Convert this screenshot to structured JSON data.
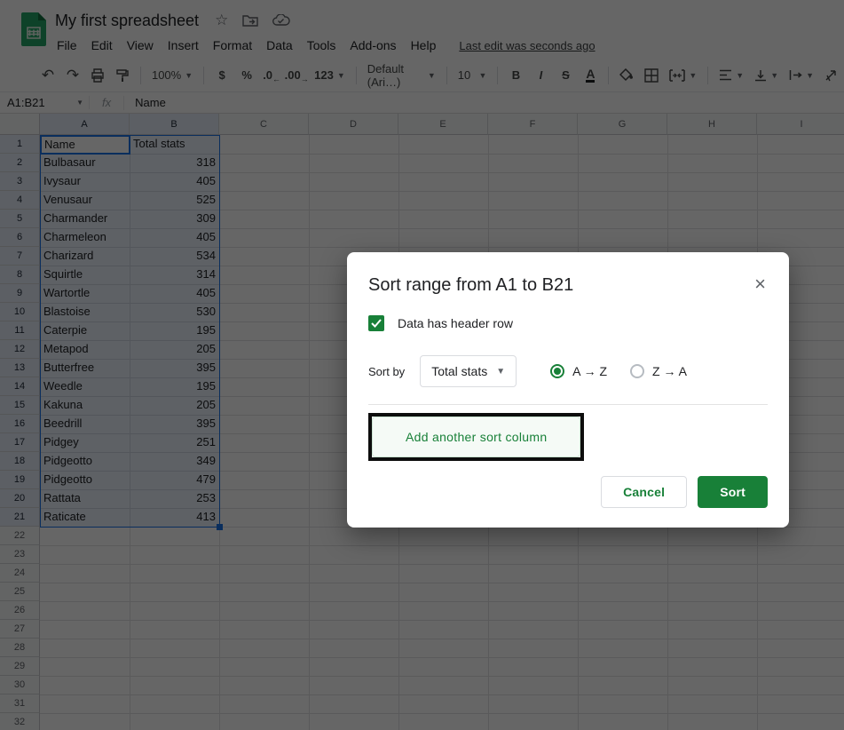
{
  "app": {
    "title": "My first spreadsheet",
    "last_edit": "Last edit was seconds ago",
    "menus": [
      "File",
      "Edit",
      "View",
      "Insert",
      "Format",
      "Data",
      "Tools",
      "Add-ons",
      "Help"
    ]
  },
  "toolbar": {
    "undo": "↶",
    "redo": "↷",
    "zoom": "100%",
    "currency": "$",
    "percent": "%",
    "decimal_decrease": ".0",
    "decimal_increase": ".00",
    "more_formats": "123",
    "font": "Default (Ari…)",
    "font_size": "10",
    "bold": "B",
    "italic": "I",
    "strikethrough": "S",
    "text_color": "A"
  },
  "formula_bar": {
    "name_box": "A1:B21",
    "fx": "fx",
    "content": "Name"
  },
  "grid": {
    "columns": [
      "A",
      "B",
      "C",
      "D",
      "E",
      "F",
      "G",
      "H",
      "I"
    ],
    "visible_row_count": 32,
    "selected_range_rows": 21,
    "table": {
      "headers": [
        "Name",
        "Total stats"
      ],
      "rows": [
        [
          "Bulbasaur",
          "318"
        ],
        [
          "Ivysaur",
          "405"
        ],
        [
          "Venusaur",
          "525"
        ],
        [
          "Charmander",
          "309"
        ],
        [
          "Charmeleon",
          "405"
        ],
        [
          "Charizard",
          "534"
        ],
        [
          "Squirtle",
          "314"
        ],
        [
          "Wartortle",
          "405"
        ],
        [
          "Blastoise",
          "530"
        ],
        [
          "Caterpie",
          "195"
        ],
        [
          "Metapod",
          "205"
        ],
        [
          "Butterfree",
          "395"
        ],
        [
          "Weedle",
          "195"
        ],
        [
          "Kakuna",
          "205"
        ],
        [
          "Beedrill",
          "395"
        ],
        [
          "Pidgey",
          "251"
        ],
        [
          "Pidgeotto",
          "349"
        ],
        [
          "Pidgeotto",
          "479"
        ],
        [
          "Rattata",
          "253"
        ],
        [
          "Raticate",
          "413"
        ]
      ]
    }
  },
  "dialog": {
    "title": "Sort range from A1 to B21",
    "close": "×",
    "header_checkbox_label": "Data has header row",
    "header_checkbox_checked": true,
    "sort_by_label": "Sort by",
    "sort_by_value": "Total stats",
    "order_asc_label": "A → Z",
    "order_desc_label": "Z → A",
    "order_selected": "A → Z",
    "add_column_label": "Add another sort column",
    "cancel_label": "Cancel",
    "sort_label": "Sort"
  },
  "colors": {
    "accent_green": "#188038",
    "selection_blue": "#1a73e8"
  }
}
